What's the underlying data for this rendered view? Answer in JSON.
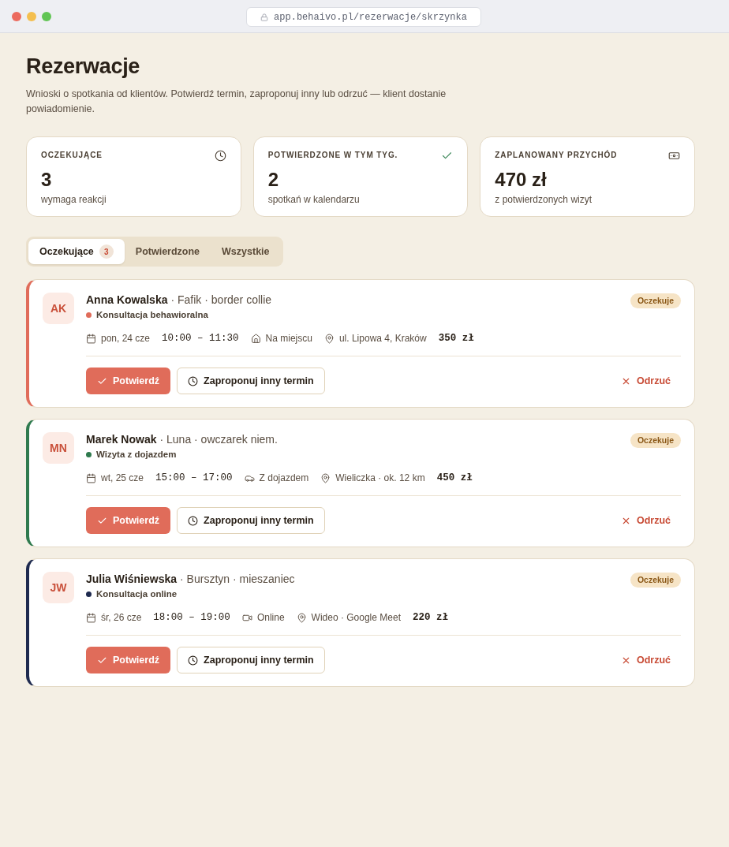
{
  "browser": {
    "url": "app.behaivo.pl/rezerwacje/skrzynka"
  },
  "page": {
    "title": "Rezerwacje",
    "description": "Wnioski o spotkania od klientów. Potwierdź termin, zaproponuj inny lub odrzuć — klient dostanie powiadomienie."
  },
  "stats": [
    {
      "kind": "pending",
      "label": "OCZEKUJĄCE",
      "value": "3",
      "note": "wymaga reakcji"
    },
    {
      "kind": "confirmed",
      "label": "POTWIERDZONE W TYM TYG.",
      "value": "2",
      "note": "spotkań w kalendarzu"
    },
    {
      "kind": "revenue",
      "label": "ZAPLANOWANY PRZYCHÓD",
      "value": "470 zł",
      "note": "z potwierdzonych wizyt"
    }
  ],
  "tabs": [
    {
      "label": "Oczekujące",
      "count": "3",
      "selected": true
    },
    {
      "label": "Potwierdzone",
      "selected": false
    },
    {
      "label": "Wszystkie",
      "selected": false
    }
  ],
  "bookings": [
    {
      "color": "#e06c5a",
      "initials": "AK",
      "client": "Anna Kowalska",
      "details": "· Fafik · border collie",
      "service": "Konsultacja behawioralna",
      "status": "Oczekuje",
      "date": "pon, 24 cze",
      "time": "10:00 – 11:30",
      "mode": {
        "kind": "onsite",
        "label": "Na miejscu"
      },
      "location": "ul. Lipowa 4, Kraków",
      "price": "350 zł",
      "actions": {
        "confirm": "Potwierdź",
        "propose": "Zaproponuj inny termin",
        "reject": "Odrzuć"
      }
    },
    {
      "color": "#2f7a4e",
      "initials": "MN",
      "client": "Marek Nowak",
      "details": "· Luna · owczarek niem.",
      "service": "Wizyta z dojazdem",
      "status": "Oczekuje",
      "date": "wt, 25 cze",
      "time": "15:00 – 17:00",
      "mode": {
        "kind": "travel",
        "label": "Z dojazdem"
      },
      "location": "Wieliczka · ok. 12 km",
      "price": "450 zł",
      "actions": {
        "confirm": "Potwierdź",
        "propose": "Zaproponuj inny termin",
        "reject": "Odrzuć"
      }
    },
    {
      "color": "#1e2a4f",
      "initials": "JW",
      "client": "Julia Wiśniewska",
      "details": "· Bursztyn · mieszaniec",
      "service": "Konsultacja online",
      "status": "Oczekuje",
      "date": "śr, 26 cze",
      "time": "18:00 – 19:00",
      "mode": {
        "kind": "online",
        "label": "Online"
      },
      "location": "Wideo · Google Meet",
      "price": "220 zł",
      "actions": {
        "confirm": "Potwierdź",
        "propose": "Zaproponuj inny termin",
        "reject": "Odrzuć"
      }
    }
  ]
}
